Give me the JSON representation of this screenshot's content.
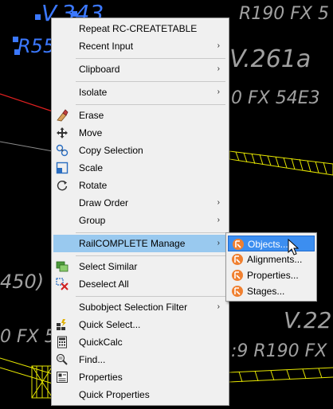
{
  "background_labels": {
    "v343": "V.343",
    "r55": "R55",
    "r190_top": "R190 FX 5",
    "v261a": "V.261a",
    "r0fx54e3": "0 FX 54E3",
    "l450": "450)",
    "l0fx5": "0 FX 5",
    "v22": "V.22",
    "r9r190": ":9 R190 FX"
  },
  "main_menu": {
    "repeat": "Repeat RC-CREATETABLE",
    "recent_input": "Recent Input",
    "clipboard": "Clipboard",
    "isolate": "Isolate",
    "erase": "Erase",
    "move": "Move",
    "copy_selection": "Copy Selection",
    "scale": "Scale",
    "rotate": "Rotate",
    "draw_order": "Draw Order",
    "group": "Group",
    "railcomplete_manage": "RailCOMPLETE Manage",
    "select_similar": "Select Similar",
    "deselect_all": "Deselect All",
    "subobject_filter": "Subobject Selection Filter",
    "quick_select": "Quick Select...",
    "quickcalc": "QuickCalc",
    "find": "Find...",
    "properties": "Properties",
    "quick_properties": "Quick Properties",
    "submenu_arrow": "›"
  },
  "sub_menu": {
    "objects": "Objects...",
    "alignments": "Alignments...",
    "properties": "Properties...",
    "stages": "Stages..."
  },
  "colors": {
    "menu_bg": "#f0f0f0",
    "highlight": "#99c9ef",
    "sub_highlight": "#3c8ef0",
    "cad_text": "#a0a0a0",
    "cad_yellow": "#e6e600",
    "cad_blue": "#3b78ff",
    "cad_red": "#e02020"
  }
}
